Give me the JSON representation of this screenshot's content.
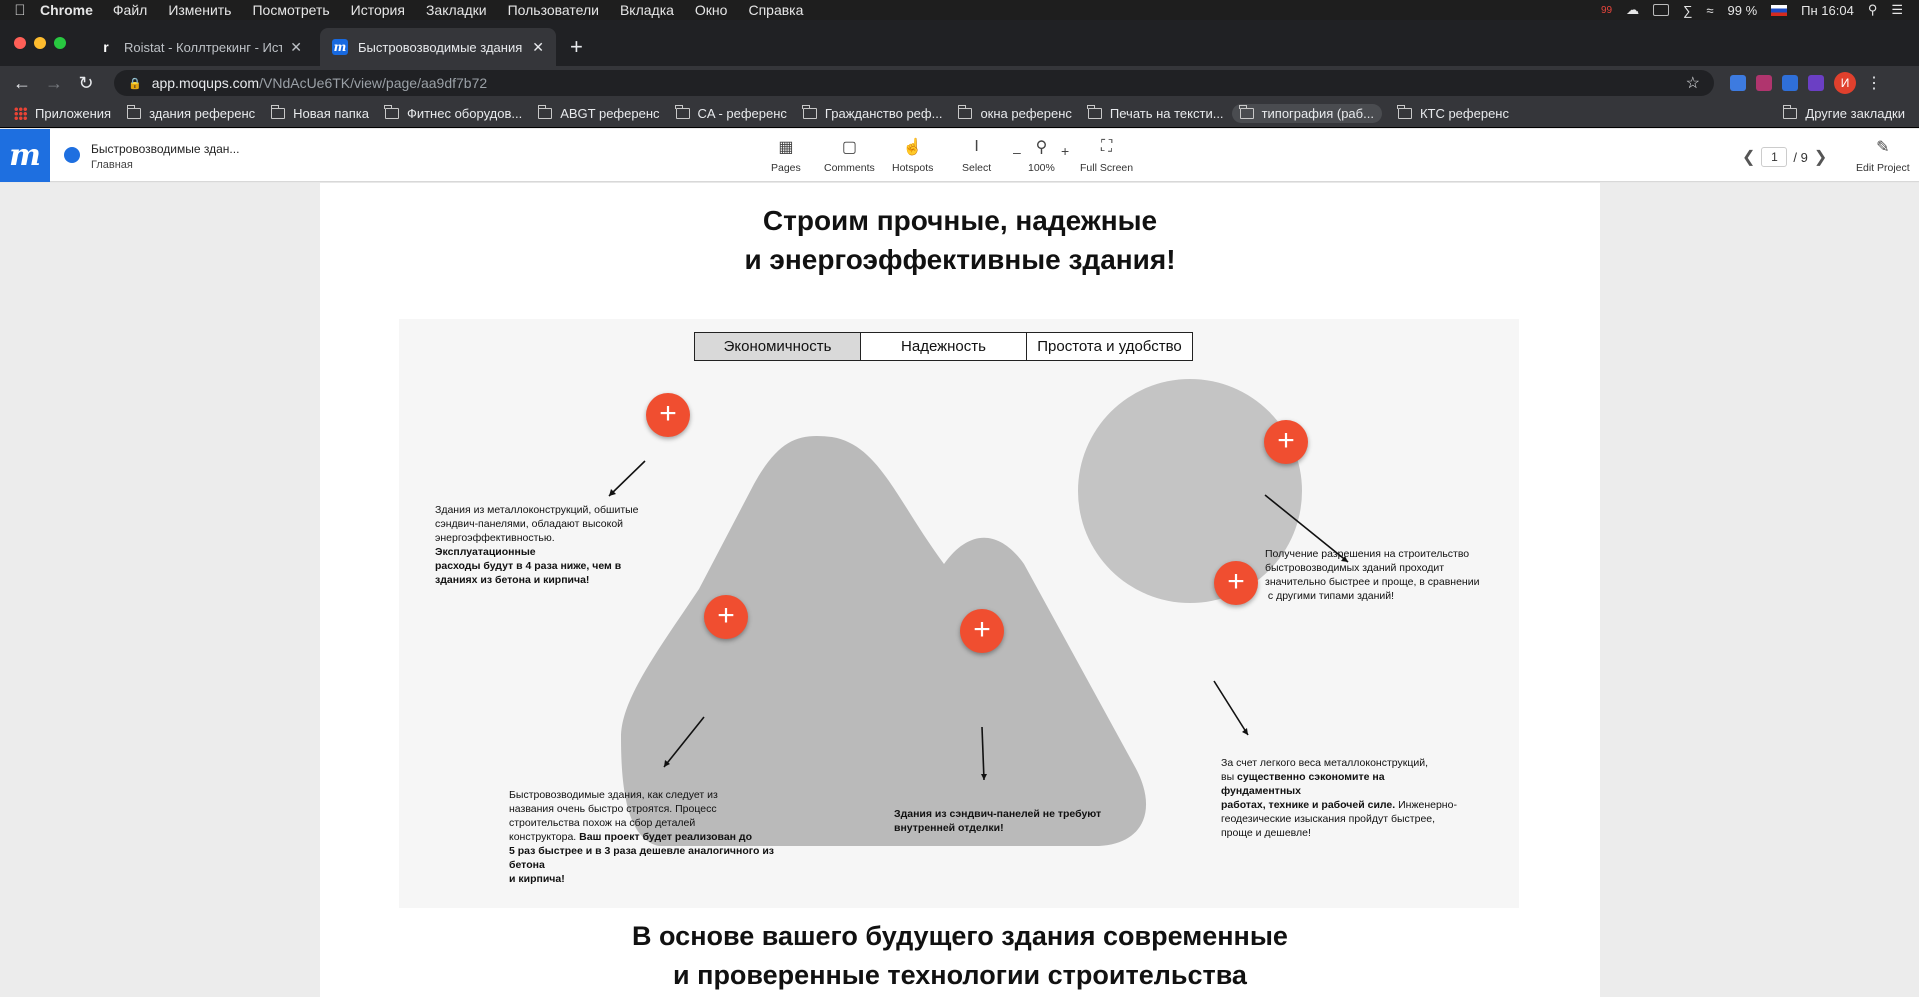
{
  "menubar": {
    "app": "Chrome",
    "items": [
      "Файл",
      "Изменить",
      "Посмотреть",
      "История",
      "Закладки",
      "Пользователи",
      "Вкладка",
      "Окно",
      "Справка"
    ],
    "badge": "99",
    "battery": "99 %",
    "clock": "Пн 16:04"
  },
  "tabs": [
    {
      "title": "Roistat - Коллтрекинг - Истор",
      "favicon": "r"
    },
    {
      "title": "Быстровозводимые здания (f",
      "favicon": "m"
    }
  ],
  "toolbar": {
    "url_host": "app.moqups.com",
    "url_path": "/VNdAcUe6TK/view/page/aa9df7b72",
    "avatar_letter": "И"
  },
  "bookmarks": {
    "apps": "Приложения",
    "items": [
      "здания референс",
      "Новая папка",
      "Фитнес оборудов...",
      "ABGT референс",
      "CA - референс",
      "Гражданство реф...",
      "окна референс",
      "Печать на тексти...",
      "типография (раб...",
      "КТС референс"
    ],
    "other": "Другие закладки"
  },
  "moqups": {
    "project": "Быстровозводимые здан...",
    "page": "Главная",
    "tools": {
      "pages": "Pages",
      "comments": "Comments",
      "hotspots": "Hotspots",
      "select": "Select",
      "zoom": "100%",
      "fullscreen": "Full Screen",
      "edit": "Edit Project"
    },
    "page_current": "1",
    "page_total": "/ 9"
  },
  "content": {
    "heading1_line1": "Строим прочные, надежные",
    "heading1_line2": "и энергоэффективные здания!",
    "tabs": [
      "Экономичность",
      "Надежность",
      "Простота и удобство"
    ],
    "t1_a": "Здания из металлоконструкций, обшитые",
    "t1_b": "сэндвич-панелями, обладают высокой",
    "t1_c": "энергоэффективностью.",
    "t1_d": "Эксплуатационные",
    "t1_e": "расходы будут в 4 раза ниже, чем в",
    "t1_f": "зданиях из бетона и кирпича!",
    "t2_a": "Быстровозводимые здания, как следует из",
    "t2_b": "названия очень быстро строятся. Процесс",
    "t2_c": "строительства похож на сбор деталей",
    "t2_d": "конструктора.",
    "t2_e": "Ваш проект будет реализован до",
    "t2_f": "5 раз быстрее и в 3 раза дешевле аналогичного из бетона",
    "t2_g": "и кирпича!",
    "t3_a": "Здания из сэндвич-панелей не требуют",
    "t3_b": "внутренней отделки!",
    "t4_a": "Получение разрешения на строительство",
    "t4_b": "быстровозводимых зданий проходит",
    "t4_c": "значительно быстрее и проще, в сравнении",
    "t4_d": " с другими типами зданий!",
    "t5_a": "За счет легкого веса металлоконструкций,",
    "t5_b": "вы",
    "t5_c": "существенно сэкономите на фундаментных",
    "t5_d": "работах, технике и рабочей силе.",
    "t5_e": "Инженерно-",
    "t5_f": "геодезические изыскания пройдут быстрее,",
    "t5_g": "проще и дешевле!",
    "heading2_line1": "В основе вашего будущего здания современные",
    "heading2_line2": "и проверенные технологии строительства",
    "plus": "+"
  }
}
